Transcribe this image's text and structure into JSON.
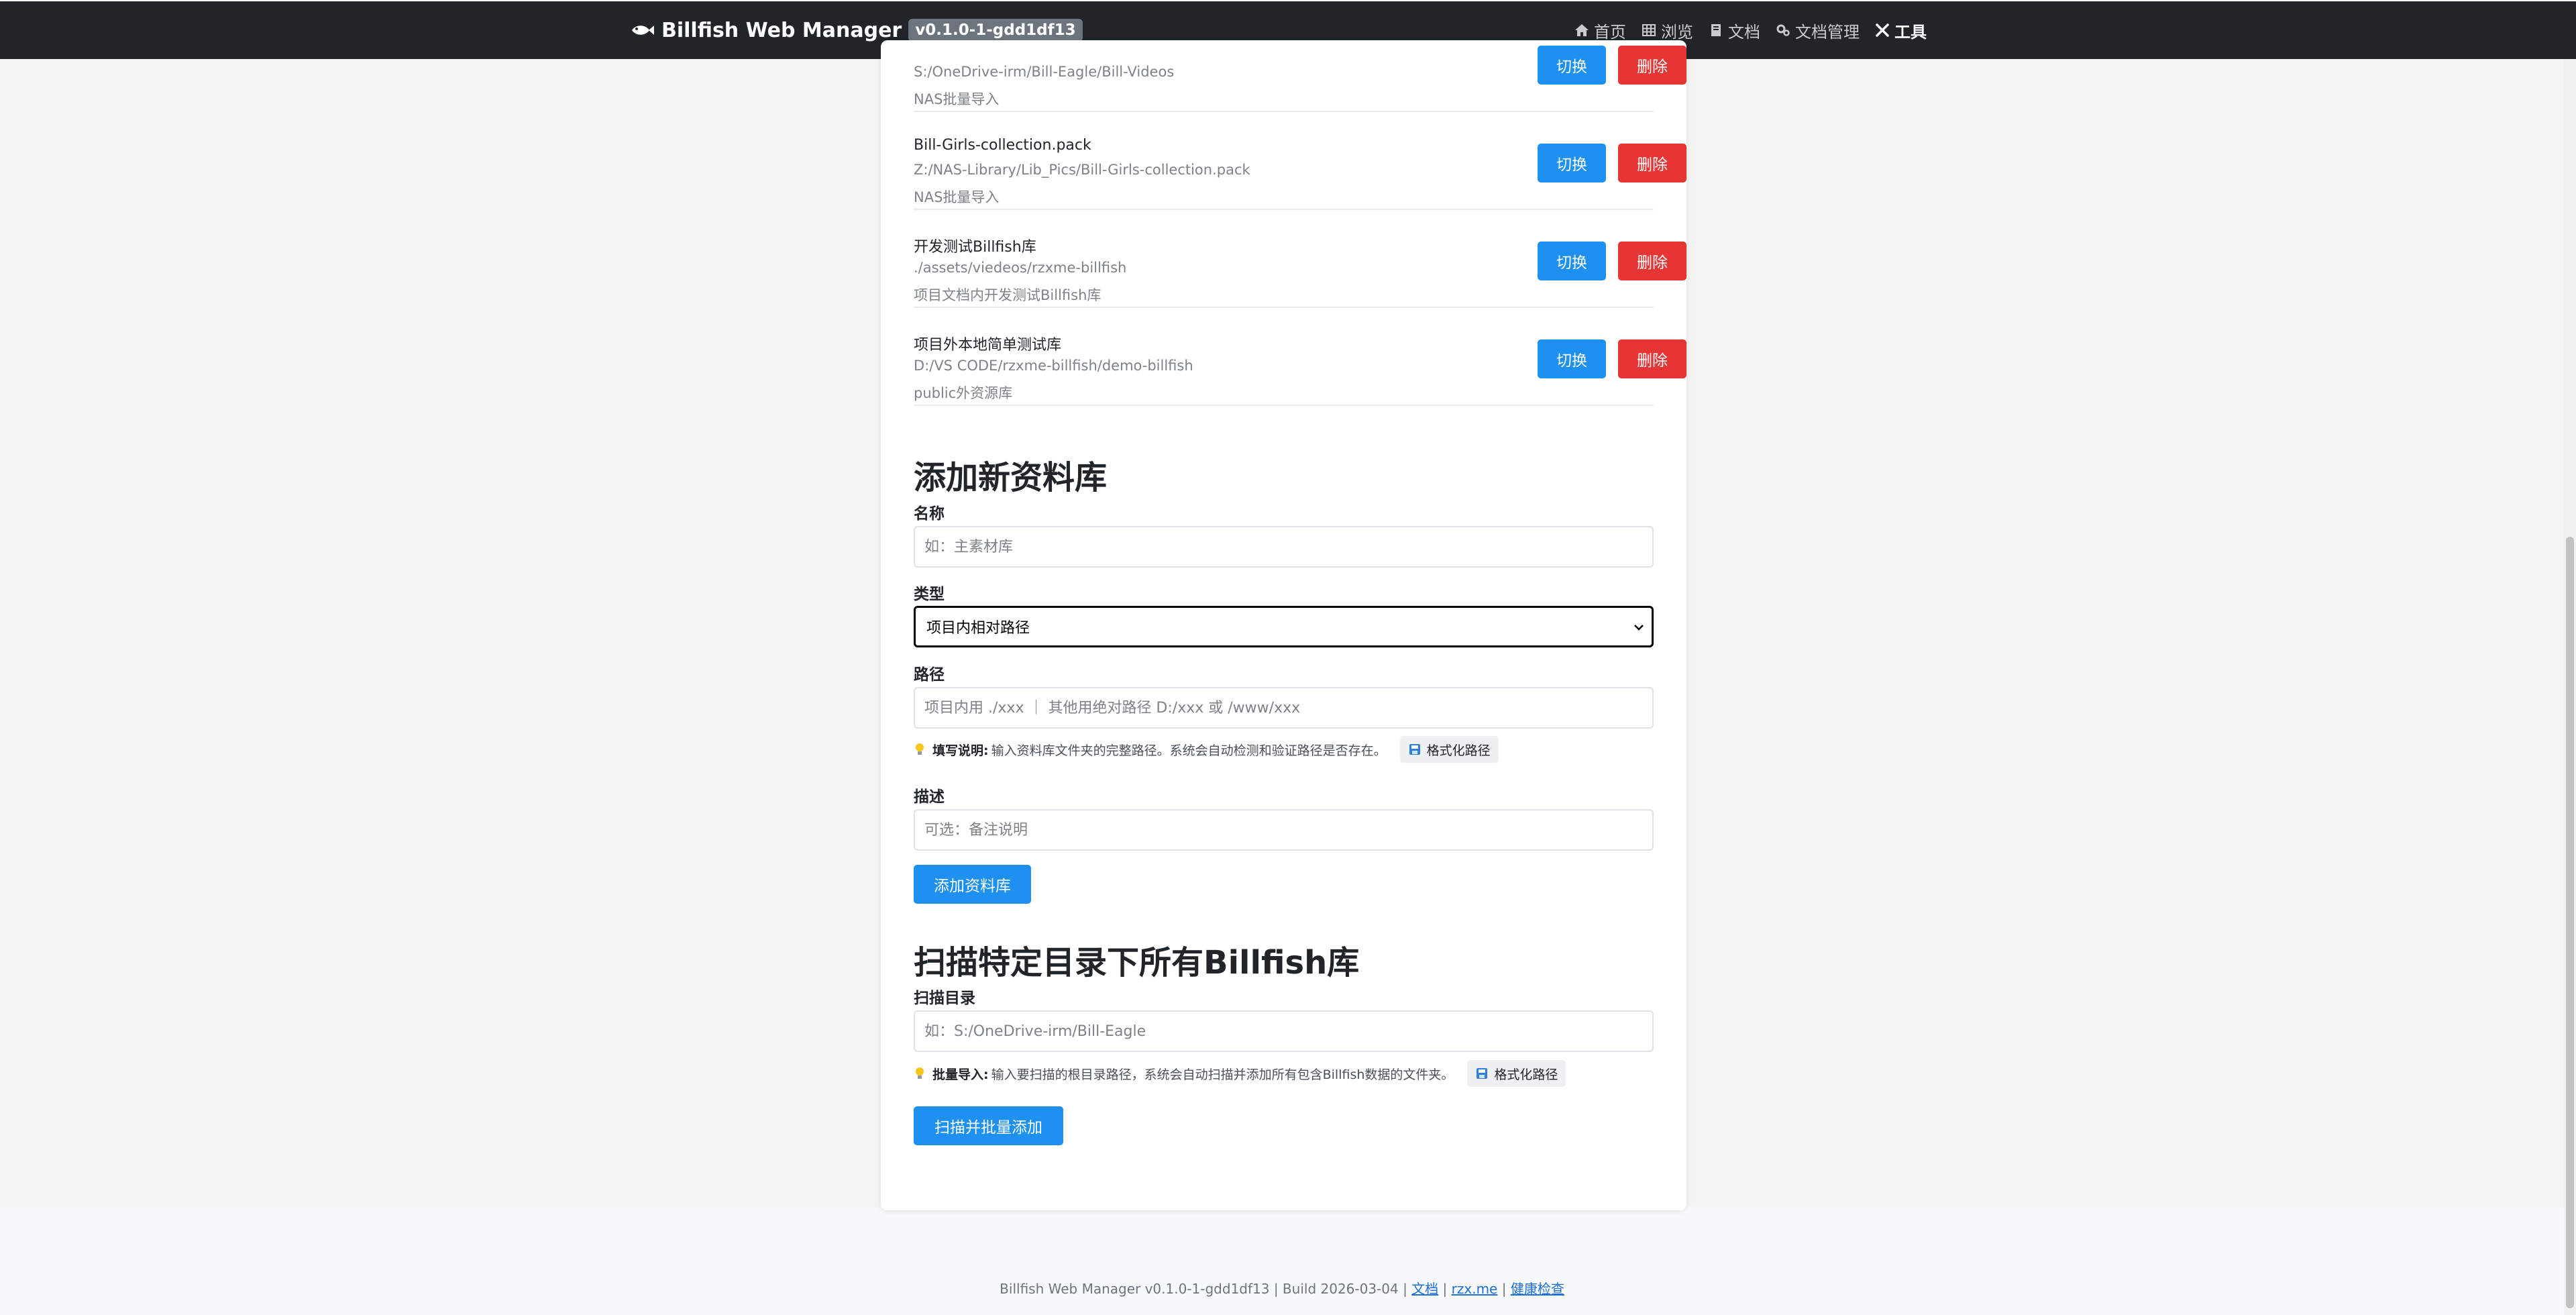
{
  "nav": {
    "brand": "Billfish Web Manager",
    "version": "v0.1.0-1-gdd1df13",
    "links": [
      {
        "label": "首页",
        "icon": "home-icon"
      },
      {
        "label": "浏览",
        "icon": "grid-icon"
      },
      {
        "label": "文档",
        "icon": "book-icon"
      },
      {
        "label": "文档管理",
        "icon": "gears-icon"
      },
      {
        "label": "工具",
        "icon": "tools-icon",
        "active": true
      }
    ]
  },
  "libraries": [
    {
      "name": "",
      "path": "S:/OneDrive-irm/Bill-Eagle/Bill-Videos",
      "desc": "NAS批量导入"
    },
    {
      "name": "Bill-Girls-collection.pack",
      "path": "Z:/NAS-Library/Lib_Pics/Bill-Girls-collection.pack",
      "desc": "NAS批量导入"
    },
    {
      "name": "开发测试Billfish库",
      "path": "./assets/viedeos/rzxme-billfish",
      "desc": "项目文档内开发测试Billfish库"
    },
    {
      "name": "项目外本地简单测试库",
      "path": "D:/VS CODE/rzxme-billfish/demo-billfish",
      "desc": "public外资源库"
    }
  ],
  "library_actions": {
    "switch_label": "切换",
    "delete_label": "删除"
  },
  "add_form": {
    "title": "添加新资料库",
    "name_label": "名称",
    "name_placeholder": "如：主素材库",
    "type_label": "类型",
    "type_value": "项目内相对路径",
    "path_label": "路径",
    "path_placeholder": "项目内用 ./xxx ｜ 其他用绝对路径 D:/xxx 或 /www/xxx",
    "hint_title": "填写说明:",
    "hint_text": "输入资料库文件夹的完整路径。系统会自动检测和验证路径是否存在。",
    "format_label": "格式化路径",
    "desc_label": "描述",
    "desc_placeholder": "可选：备注说明",
    "submit_label": "添加资料库"
  },
  "scan_form": {
    "title": "扫描特定目录下所有Billfish库",
    "dir_label": "扫描目录",
    "dir_placeholder": "如：S:/OneDrive-irm/Bill-Eagle",
    "hint_title": "批量导入:",
    "hint_text": "输入要扫描的根目录路径，系统会自动扫描并添加所有包含Billfish数据的文件夹。",
    "format_label": "格式化路径",
    "submit_label": "扫描并批量添加"
  },
  "footer": {
    "text": "Billfish Web Manager v0.1.0-1-gdd1df13 | Build 2026-03-04 |",
    "link_docs": "文档",
    "link_site": "rzx.me",
    "link_health": "健康检查"
  },
  "colors": {
    "primary": "#1e90f0",
    "danger": "#e53535",
    "navbar": "#212529"
  }
}
